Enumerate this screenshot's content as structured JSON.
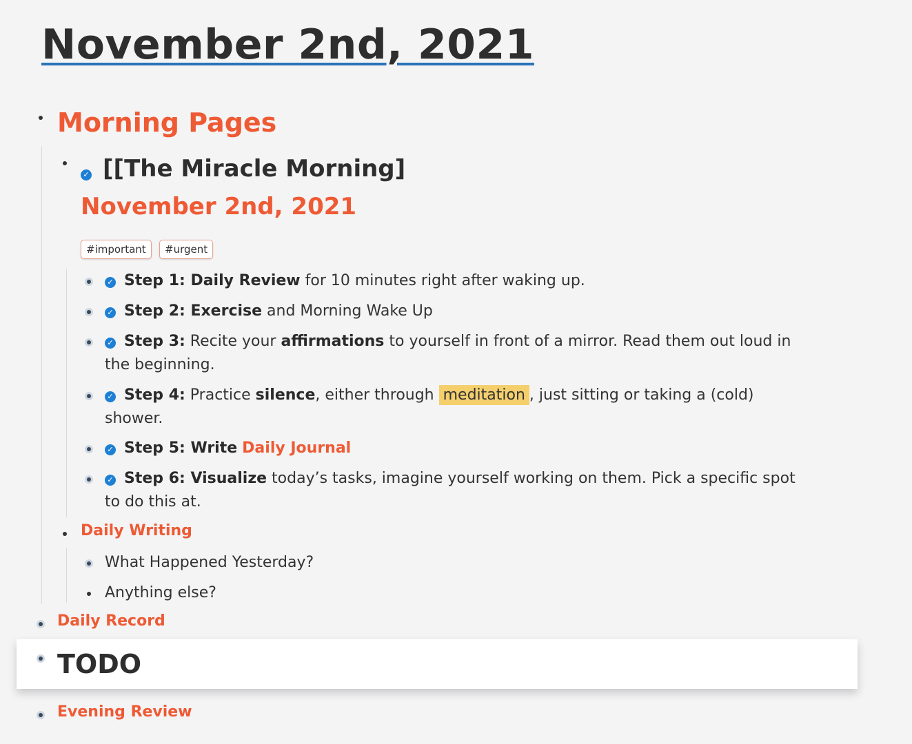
{
  "page": {
    "title": "November 2nd, 2021"
  },
  "blocks": {
    "morning_pages": "Morning Pages",
    "miracle_morning": "[[The Miracle Morning]",
    "subtitle_date": "November 2nd, 2021",
    "tags": [
      "#important",
      "#urgent"
    ],
    "steps": [
      {
        "label": "Step 1: Daily Review",
        "rest": "for 10 minutes right after waking up."
      },
      {
        "label": "Step 2: Exercise",
        "rest": "and Morning Wake Up"
      },
      {
        "label": "Step 3:",
        "pre": "Recite your",
        "bold": "affirmations",
        "post": "to yourself in front of a mirror. Read them out loud in",
        "line2": "the beginning."
      },
      {
        "label": "Step 4:",
        "pre": "Practice",
        "bold": "silence",
        "mid": ", either through",
        "highlight": "meditation",
        "post": ", just sitting or taking a (cold)",
        "line2": "shower."
      },
      {
        "label": "Step 5: Write",
        "link": "Daily Journal"
      },
      {
        "label": "Step 6: Visualize",
        "rest": "today’s tasks, imagine yourself working on them. Pick a specific spot",
        "line2": "to do this at."
      }
    ],
    "daily_writing": "Daily Writing",
    "daily_writing_items": [
      "What Happened Yesterday?",
      "Anything else?"
    ],
    "daily_record": "Daily Record",
    "todo": "TODO",
    "evening_review": "Evening Review"
  },
  "colors": {
    "accent": "#ee5a34",
    "check": "#1e80d4",
    "underline": "#2a73b8",
    "highlight": "#f4cf6c"
  }
}
